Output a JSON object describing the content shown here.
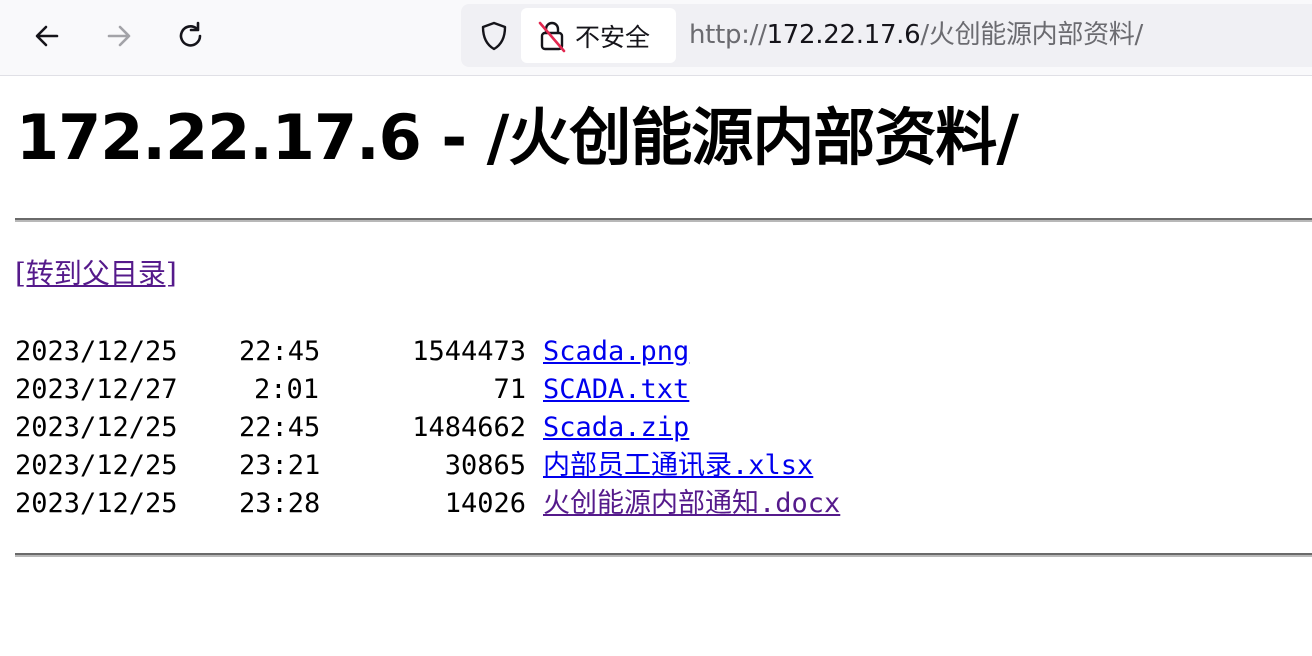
{
  "browser": {
    "back_icon": "arrow-left-icon",
    "forward_icon": "arrow-right-icon",
    "reload_icon": "reload-icon",
    "shield_icon": "shield-icon",
    "security_icon": "lock-broken-icon",
    "security_label": "不安全",
    "url_scheme": "http://",
    "url_host": "172.22.17.6",
    "url_path": "/火创能源内部资料/"
  },
  "page": {
    "heading": "172.22.17.6 - /火创能源内部资料/",
    "parent_link": "[转到父目录]"
  },
  "listing": [
    {
      "date": "2023/12/25",
      "time": "22:45",
      "size": "1544473",
      "name": "Scada.png",
      "visited": false
    },
    {
      "date": "2023/12/27",
      "time": "2:01",
      "size": "71",
      "name": "SCADA.txt",
      "visited": false
    },
    {
      "date": "2023/12/25",
      "time": "22:45",
      "size": "1484662",
      "name": "Scada.zip",
      "visited": false
    },
    {
      "date": "2023/12/25",
      "time": "23:21",
      "size": "30865",
      "name": "内部员工通讯录.xlsx",
      "visited": false
    },
    {
      "date": "2023/12/25",
      "time": "23:28",
      "size": "14026",
      "name": "火创能源内部通知.docx",
      "visited": true
    }
  ],
  "colors": {
    "link": "#0000ee",
    "visited_link": "#551a8b",
    "toolbar_bg": "#f9f9fb"
  }
}
